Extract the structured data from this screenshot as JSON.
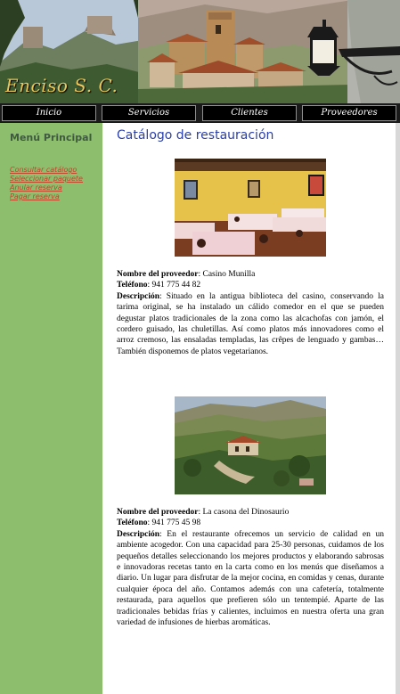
{
  "brand": {
    "name": "Enciso S. C."
  },
  "nav": {
    "items": [
      "Inicio",
      "Servicios",
      "Clientes",
      "Proveedores"
    ]
  },
  "sidebar": {
    "title": "Menú Principal",
    "links": [
      "Consultar catálogo",
      "Seleccionar paquete",
      "Anular reserva",
      "Pagar reserva"
    ]
  },
  "main": {
    "title": "Catálogo de restauración",
    "entries": [
      {
        "provider_label": "Nombre del proveedor",
        "provider": "Casino Munilla",
        "phone_label": "Teléfono",
        "phone": "941 775 44 82",
        "desc_label": "Descripción",
        "desc": "Situado en la antigua biblioteca del casino, conservando la tarima original, se ha instalado un cálido comedor en el que se pueden degustar platos tradicionales de la zona como las alcachofas con jamón, el cordero guisado, las chuletillas. Así como platos más innovadores como el arroz cremoso, las ensaladas templadas, las crêpes de lenguado y gambas… También disponemos de platos vegetarianos."
      },
      {
        "provider_label": "Nombre del proveedor",
        "provider": "La casona del Dinosaurio",
        "phone_label": "Teléfono",
        "phone": "941 775 45 98",
        "desc_label": "Descripción",
        "desc": "En el restaurante ofrecemos un servicio de calidad en un ambiente acogedor. Con una capacidad para 25-30 personas, cuidamos de los pequeños detalles seleccionando los mejores productos y elaborando sabrosas e innovadoras recetas tanto en la carta como en los menús que diseñamos a diario. Un lugar para disfrutar de la mejor cocina, en comidas y cenas, durante cualquier época del año. Contamos además con una cafetería, totalmente restaurada, para aquellos que prefieren sólo un tentempié. Aparte de las tradicionales bebidas frías y calientes, incluimos en nuestra oferta una gran variedad de infusiones de hierbas aromáticas."
      }
    ]
  }
}
